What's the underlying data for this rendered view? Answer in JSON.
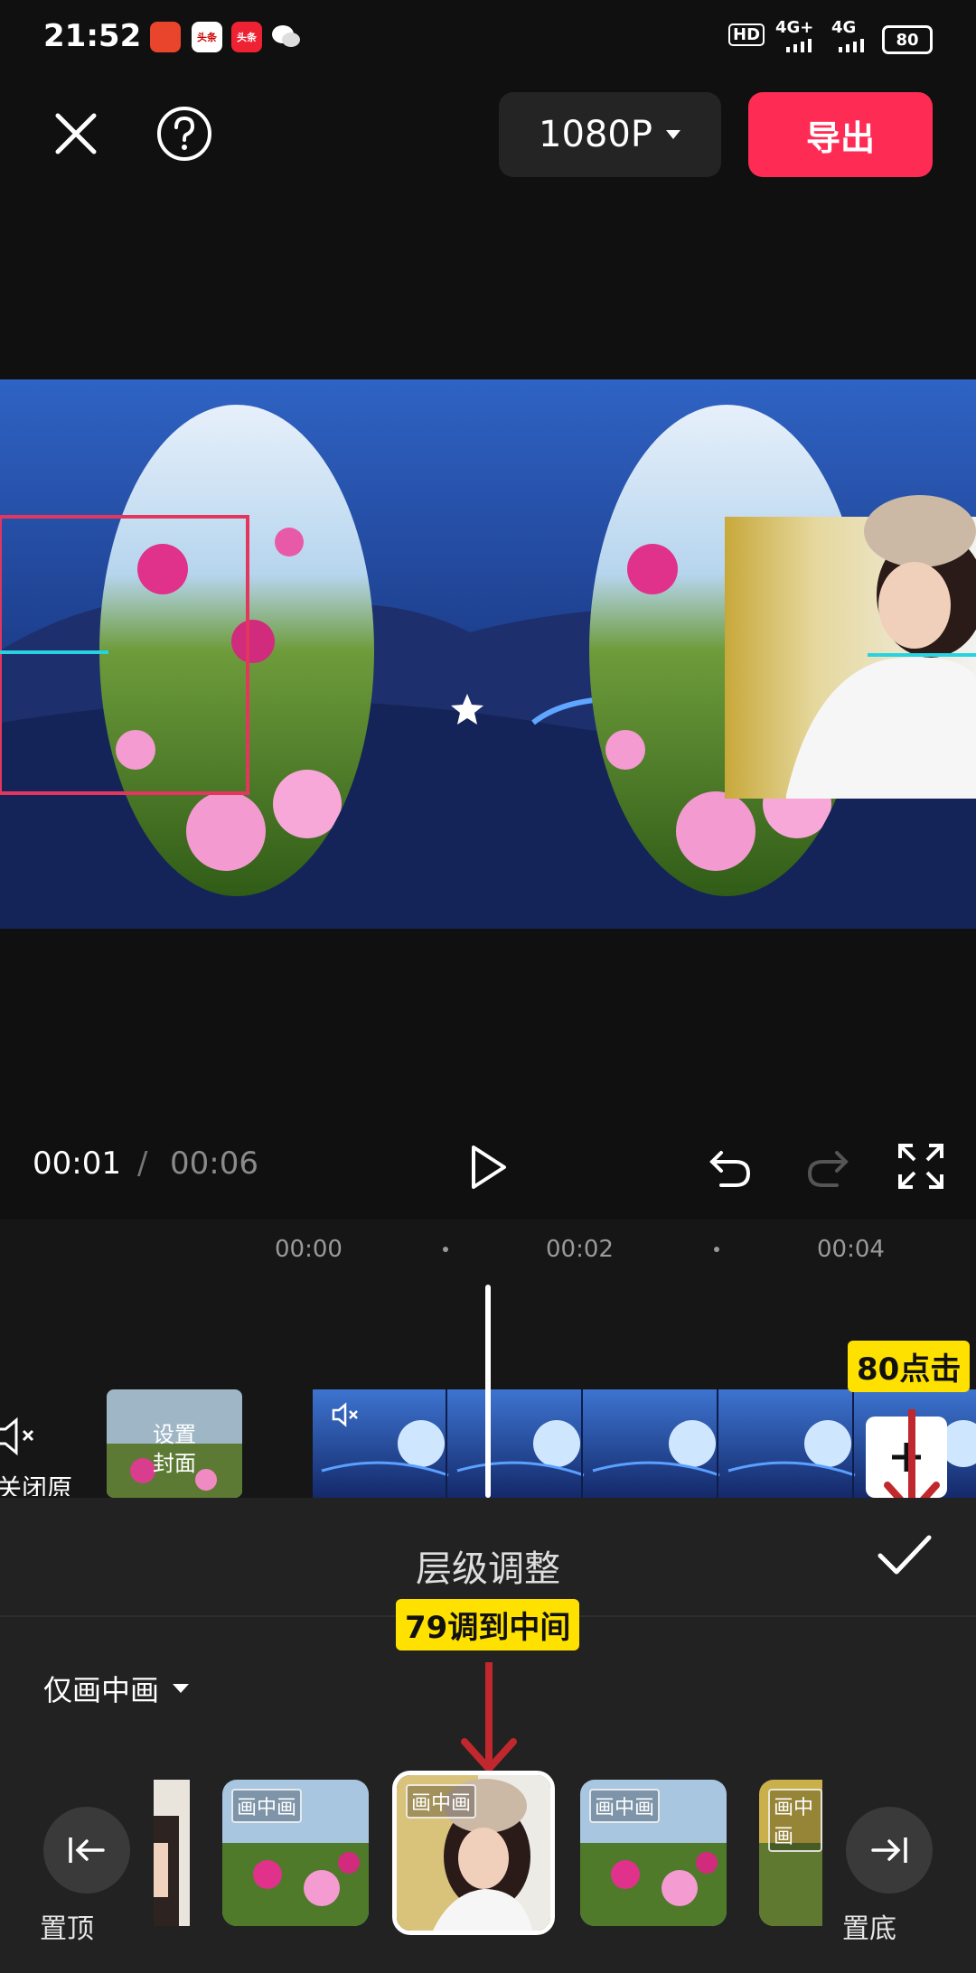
{
  "status_bar": {
    "time": "21:52",
    "app_icon_1": "头条",
    "app_icon_2": "头条",
    "signal_1": "4G+",
    "signal_2": "4G",
    "hd_badge": "HD",
    "battery": "80"
  },
  "top_bar": {
    "close_icon": "close-icon",
    "help_icon": "help-icon",
    "resolution": "1080P",
    "export_label": "导出"
  },
  "playback": {
    "current_time": "00:01",
    "separator": "/",
    "total_time": "00:06"
  },
  "timeline": {
    "ruler": [
      "00:00",
      "00:02",
      "00:04"
    ],
    "mute_label": "关闭原声",
    "cover_label_1": "设置",
    "cover_label_2": "封面",
    "annotation_80": "80点击"
  },
  "panel": {
    "title": "层级调整",
    "annotation_79": "79调到中间",
    "filter": "仅画中画",
    "thumb_tag": "画中画",
    "to_top_label": "置顶",
    "to_bottom_label": "置底"
  },
  "colors": {
    "accent": "#fe2c55",
    "annotation": "#ffe100",
    "arrow": "#c0282d"
  }
}
